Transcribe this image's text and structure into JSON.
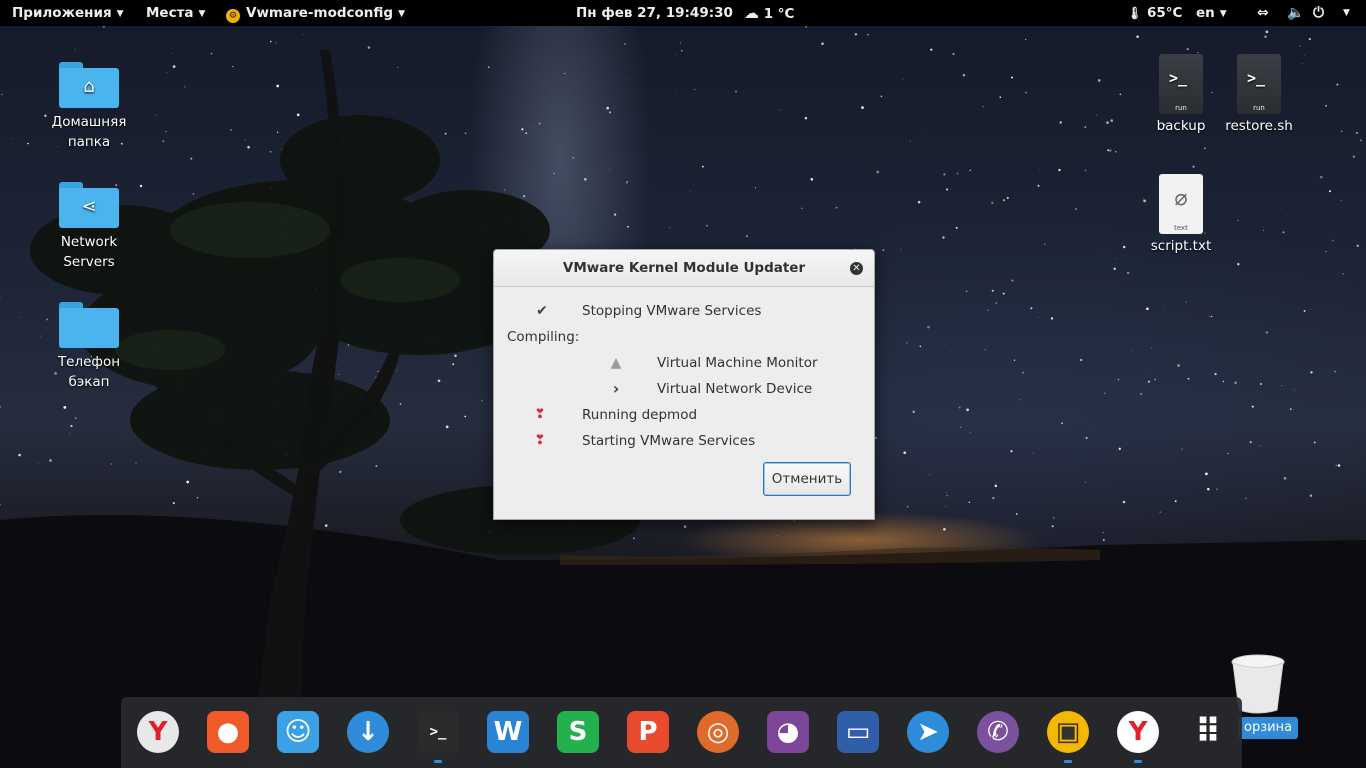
{
  "topbar": {
    "applications": "Приложения",
    "places": "Места",
    "app_menu": "Vwmare-modconfig",
    "clock": "Пн фев 27, 19:49:30",
    "weather": "1 °C",
    "temperature": "65°C",
    "language": "en"
  },
  "desktop": {
    "home_folder": "Домашняя папка",
    "network_servers": "Network Servers",
    "phone_backup": "Телефон бэкап",
    "backup": "backup",
    "restore": "restore.sh",
    "script_txt": "script.txt",
    "run_tag": "run",
    "text_tag": "text",
    "trash": "орзина"
  },
  "dialog": {
    "title": "VMware Kernel Module Updater",
    "stopping": "Stopping VMware Services",
    "compiling": "Compiling:",
    "vmm": "Virtual Machine Monitor",
    "vnd": "Virtual Network Device",
    "depmod": "Running depmod",
    "starting": "Starting VMware Services",
    "cancel": "Отменить"
  },
  "dock": {
    "items": [
      {
        "name": "yandex-browser",
        "color": "#e8e8e8"
      },
      {
        "name": "screenshot",
        "color": "#f05a28"
      },
      {
        "name": "finder",
        "color": "#3ba0e6"
      },
      {
        "name": "downloader",
        "color": "#2f8cda"
      },
      {
        "name": "terminal",
        "color": "#2b2b2b"
      },
      {
        "name": "wps-writer",
        "color": "#2a84d6"
      },
      {
        "name": "wps-spreadsheets",
        "color": "#23b14d"
      },
      {
        "name": "wps-presentation",
        "color": "#e84b2e"
      },
      {
        "name": "disk-utility",
        "color": "#e06a2c"
      },
      {
        "name": "tor-browser",
        "color": "#7d4698"
      },
      {
        "name": "remote-desktop",
        "color": "#2e5fa8"
      },
      {
        "name": "telegram-like",
        "color": "#2f8cda"
      },
      {
        "name": "viber",
        "color": "#7b519d"
      },
      {
        "name": "vmware",
        "color": "#f5b800"
      },
      {
        "name": "yandex-browser-2",
        "color": "#ffffff"
      },
      {
        "name": "app-grid",
        "color": "#ffffff"
      }
    ]
  }
}
